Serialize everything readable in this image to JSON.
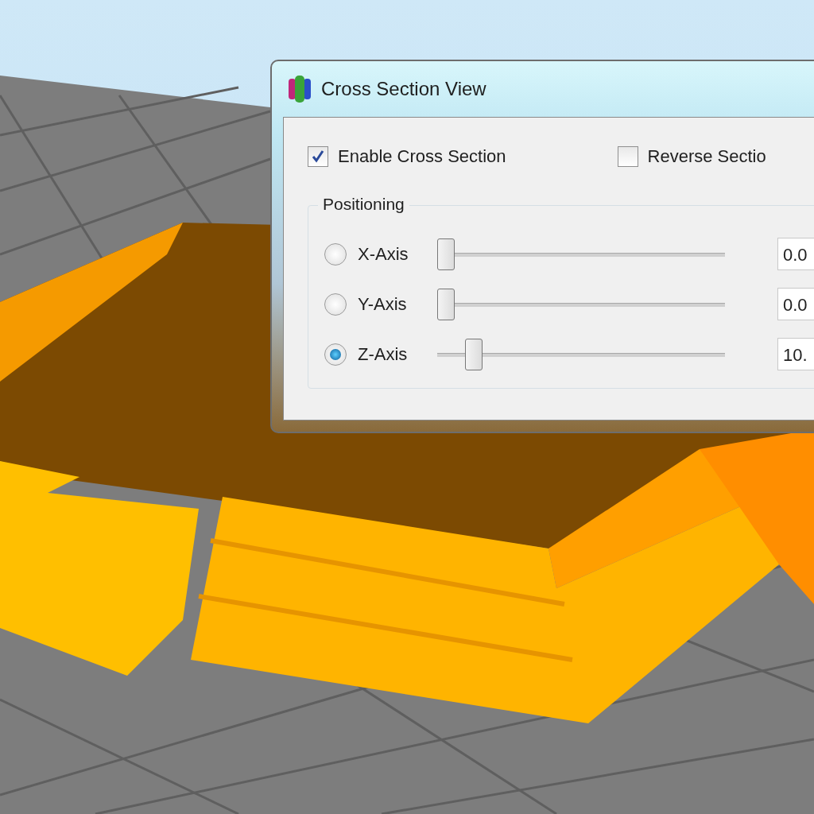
{
  "window": {
    "title": "Cross Section View"
  },
  "options": [
    {
      "label": "Enable Cross Section",
      "checked": true
    },
    {
      "label": "Reverse Sectio",
      "checked": false
    }
  ],
  "positioning": {
    "title": "Positioning",
    "axes": [
      {
        "label": "X-Axis",
        "selected": false,
        "level": 0,
        "value": "0.0"
      },
      {
        "label": "Y-Axis",
        "selected": false,
        "level": 0,
        "value": "0.0"
      },
      {
        "label": "Z-Axis",
        "selected": true,
        "level": 0.1,
        "value": "10."
      }
    ]
  }
}
